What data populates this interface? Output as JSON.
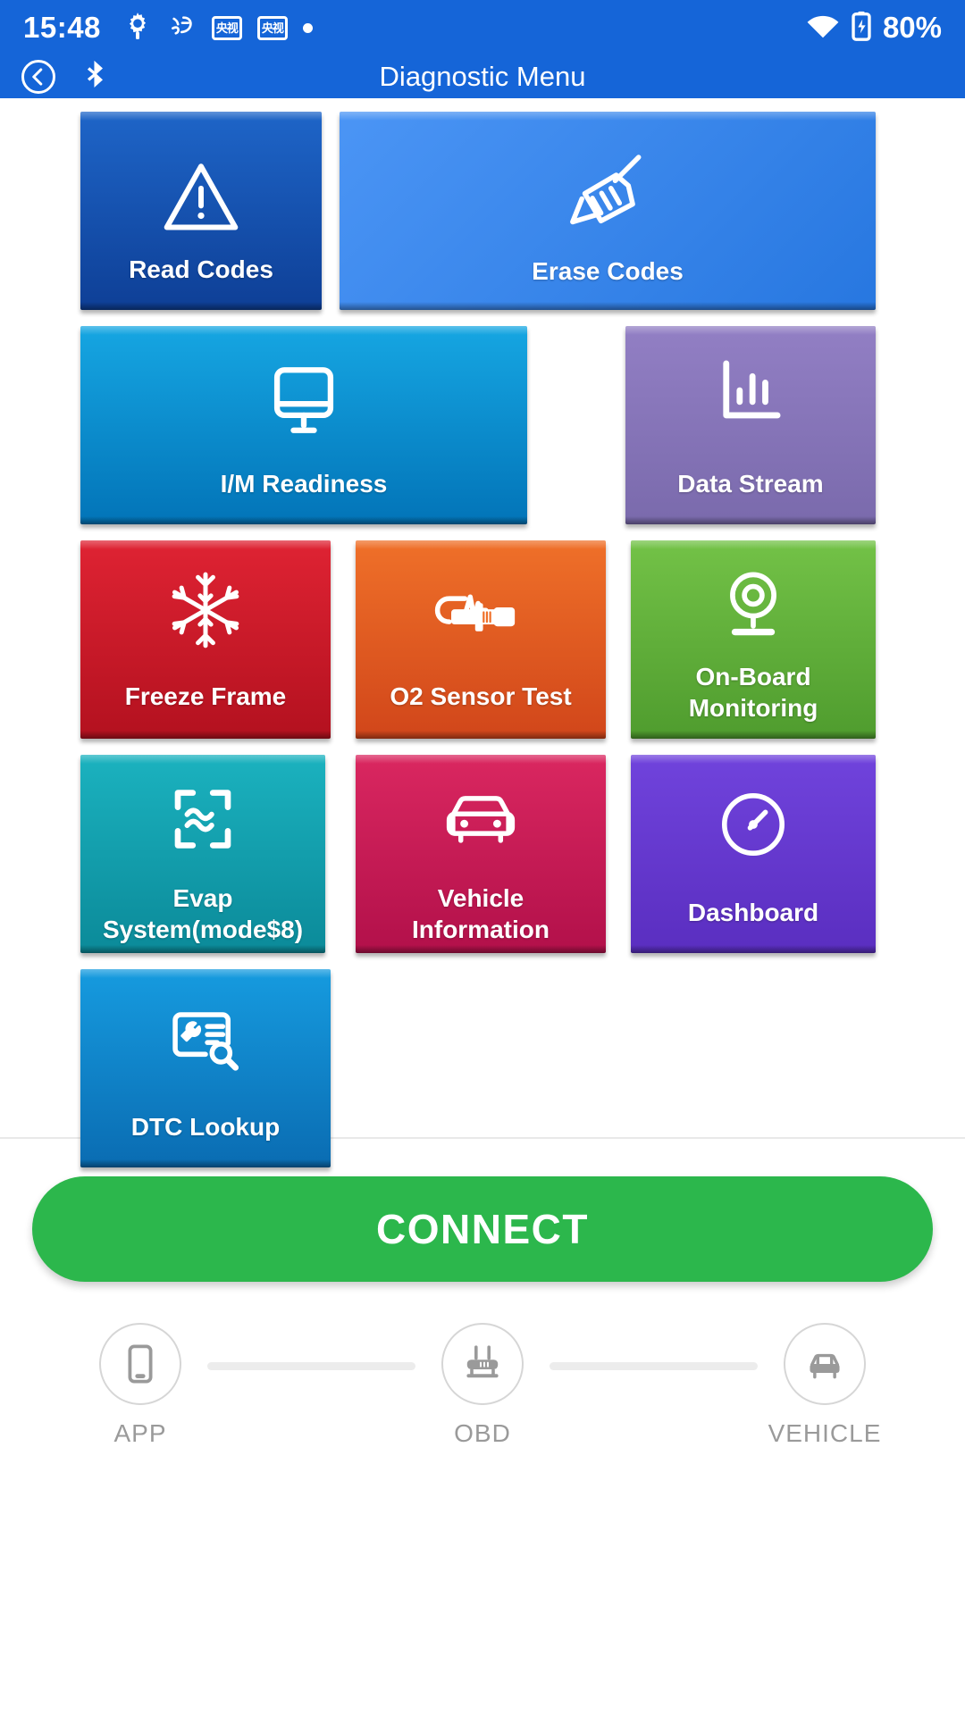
{
  "status_bar": {
    "time": "15:48",
    "left_icons": [
      "gear-icon",
      "taobao-icon",
      "cctv-badge-icon",
      "cctv-badge-icon",
      "dot-icon"
    ],
    "badge_text": "央视",
    "wifi_icon": "wifi-icon",
    "battery_icon": "battery-charging-icon",
    "battery_text": "80%"
  },
  "app_bar": {
    "back_icon": "back-circle-icon",
    "bluetooth_icon": "bluetooth-icon",
    "title": "Diagnostic Menu"
  },
  "colors": {
    "brand_blue": "#1565D8",
    "connect_green": "#2CB74C",
    "page_bg": "#FFFFFF"
  },
  "tiles": [
    {
      "label": "Read Codes",
      "icon": "warning-triangle-icon",
      "color_top": "#1E65C8",
      "color_bottom": "#0E3F96"
    },
    {
      "label": "Erase Codes",
      "icon": "broom-icon",
      "color_top": "#3D8CF0",
      "color_bottom": "#2777E0"
    },
    {
      "label": "I/M Readiness",
      "icon": "monitor-icon",
      "color_top": "#11A0DE",
      "color_bottom": "#0370B5"
    },
    {
      "label": "Data Stream",
      "icon": "bar-chart-icon",
      "color_top": "#8E7FBF",
      "color_bottom": "#7B6BAE"
    },
    {
      "label": "Freeze Frame",
      "icon": "snowflake-icon",
      "color_top": "#DB1F2E",
      "color_bottom": "#B01020"
    },
    {
      "label": "O2 Sensor Test",
      "icon": "oxygen-sensor-icon",
      "color_top": "#EC6A26",
      "color_bottom": "#D2461A"
    },
    {
      "label": "On-Board\nMonitoring",
      "icon": "webcam-icon",
      "color_top": "#6FBE44",
      "color_bottom": "#4E9C2E"
    },
    {
      "label": "Evap\nSystem(mode$8)",
      "icon": "wave-frame-icon",
      "color_top": "#17ACBA",
      "color_bottom": "#0C8D9C"
    },
    {
      "label": "Vehicle\nInformation",
      "icon": "car-icon",
      "color_top": "#D6225B",
      "color_bottom": "#B4104A"
    },
    {
      "label": "Dashboard",
      "icon": "gauge-icon",
      "color_top": "#6B3ED6",
      "color_bottom": "#5A2EC0"
    },
    {
      "label": "DTC Lookup",
      "icon": "dtc-search-icon",
      "color_top": "#1294DC",
      "color_bottom": "#0B6FB5"
    }
  ],
  "connect": {
    "label": "CONNECT"
  },
  "connection_status": {
    "nodes": [
      {
        "label": "APP",
        "icon": "phone-icon"
      },
      {
        "label": "OBD",
        "icon": "obd-dongle-icon"
      },
      {
        "label": "VEHICLE",
        "icon": "car-front-icon"
      }
    ]
  }
}
